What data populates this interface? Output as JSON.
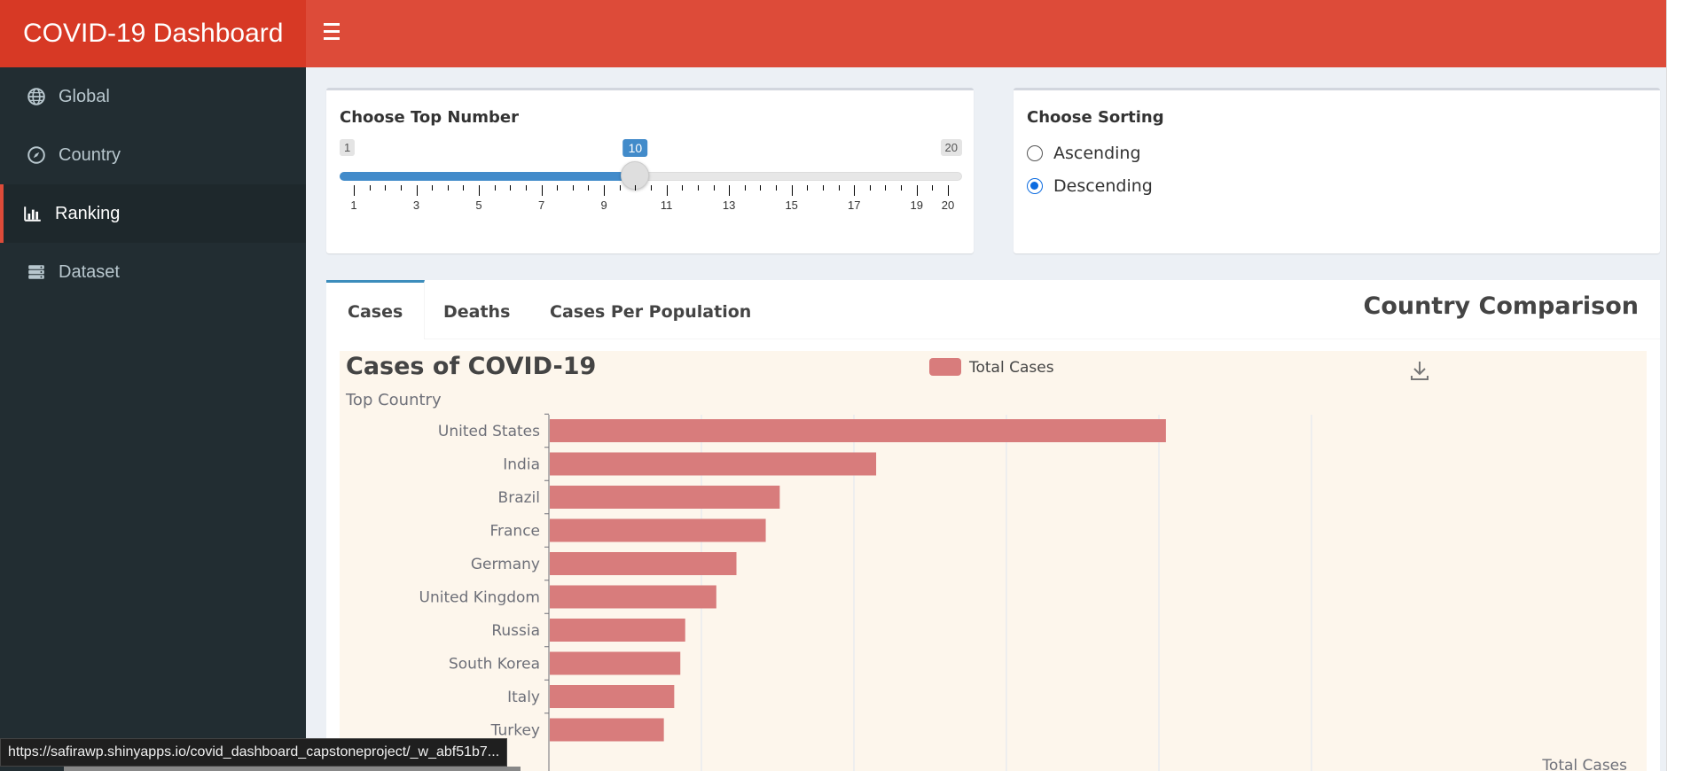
{
  "header": {
    "app_title": "COVID-19 Dashboard",
    "menu_icon": "hamburger-icon"
  },
  "sidebar": {
    "items": [
      {
        "label": "Global",
        "icon": "globe-icon",
        "active": false
      },
      {
        "label": "Country",
        "icon": "compass-icon",
        "active": false
      },
      {
        "label": "Ranking",
        "icon": "bar-chart-icon",
        "active": true
      },
      {
        "label": "Dataset",
        "icon": "database-icon",
        "active": false
      }
    ]
  },
  "top_number": {
    "title": "Choose Top Number",
    "min_label": "1",
    "max_label": "20",
    "value_label": "10",
    "value": 10,
    "min": 1,
    "max": 20,
    "tick_labels": [
      "1",
      "3",
      "5",
      "7",
      "9",
      "11",
      "13",
      "15",
      "17",
      "19",
      "20"
    ]
  },
  "sorting": {
    "title": "Choose Sorting",
    "options": [
      {
        "label": "Ascending",
        "checked": false
      },
      {
        "label": "Descending",
        "checked": true
      }
    ]
  },
  "tabs": {
    "items": [
      "Cases",
      "Deaths",
      "Cases Per Population"
    ],
    "active_index": 0,
    "box_title": "Country Comparison"
  },
  "chart_data": {
    "type": "bar",
    "orientation": "horizontal",
    "title": "Cases of COVID-19",
    "subtitle": "Top Country",
    "legend": [
      "Total Cases"
    ],
    "legend_position": "top-center",
    "xlabel": "Total Cases",
    "bar_color": "#d87c7c",
    "background": "#fdf6ec",
    "categories": [
      "United States",
      "India",
      "Brazil",
      "France",
      "Germany",
      "United Kingdom",
      "Russia",
      "South Korea",
      "Italy",
      "Turkey"
    ],
    "series": [
      {
        "name": "Total Cases",
        "values": [
          101000000,
          53500000,
          37700000,
          35400000,
          30600000,
          27300000,
          22200000,
          21400000,
          20400000,
          18700000
        ]
      }
    ],
    "xlim": [
      0,
      125000000
    ],
    "gridlines": [
      0,
      25000000,
      50000000,
      75000000,
      100000000,
      125000000
    ],
    "grid": true,
    "download_icon": "download-icon"
  },
  "statusbar": {
    "url": "https://safirawp.shinyapps.io/covid_dashboard_capstoneproject/_w_abf51b7..."
  }
}
